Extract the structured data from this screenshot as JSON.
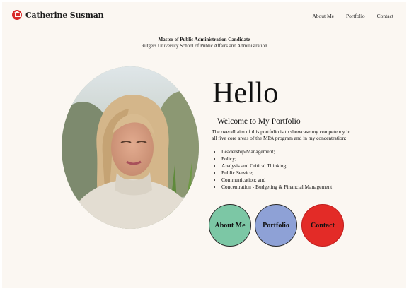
{
  "header": {
    "brand_name": "Catherine Susman",
    "nav": [
      "About Me",
      "Portfolio",
      "Contact"
    ]
  },
  "intro": {
    "degree": "Master of Public Administration Candidate",
    "school": "Rutgers University School of Public Affairs and Administration",
    "greeting": "Hello",
    "welcome": "Welcome to My Portfolio",
    "summary": "The overall aim of this portfolio is to showcase my competency in all five core areas of the MPA program and in my concentration:",
    "areas": [
      "Leadership/Management;",
      "Policy;",
      "Analysis and Critical Thinking;",
      "Public Service;",
      "Communication; and",
      "Concentration - Budgeting & Financial Management"
    ]
  },
  "buttons": [
    {
      "label": "About Me",
      "color": "#7cc7a5"
    },
    {
      "label": "Portfolio",
      "color": "#8ea1d6"
    },
    {
      "label": "Contact",
      "color": "#e32b27"
    }
  ],
  "colors": {
    "background": "#fbf7f2",
    "logo": "#d82a2a"
  }
}
